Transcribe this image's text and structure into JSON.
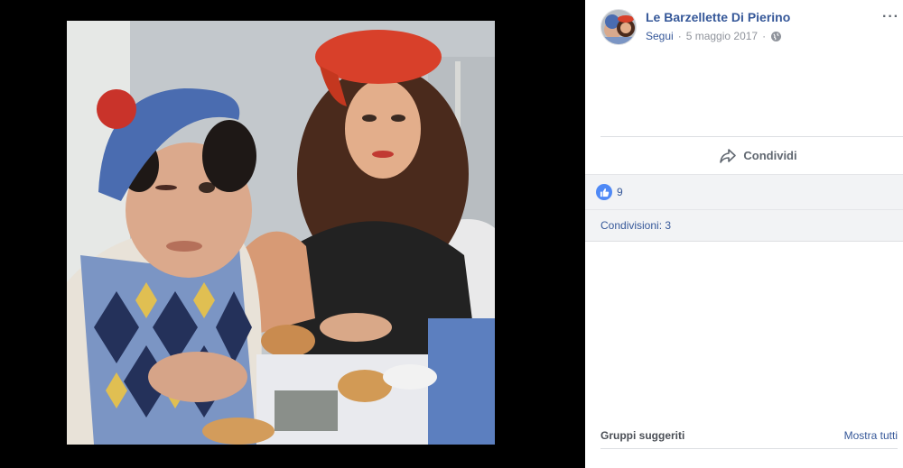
{
  "post": {
    "page_name": "Le Barzellette Di Pierino",
    "follow": "Segui",
    "date": "5 maggio 2017",
    "more": "···"
  },
  "actions": {
    "share_label": "Condividi"
  },
  "reactions": {
    "count": "9"
  },
  "shares": {
    "label": "Condivisioni: 3"
  },
  "suggested": {
    "title": "Gruppi suggeriti",
    "see_all": "Mostra tutti"
  },
  "icons": {
    "like": "like-icon",
    "share": "share-icon",
    "globe": "globe-icon",
    "more": "more-options-icon"
  },
  "colors": {
    "link": "#365899",
    "like_badge": "#4f89f6",
    "muted": "#90949c",
    "panel_bg": "#f2f3f5"
  }
}
